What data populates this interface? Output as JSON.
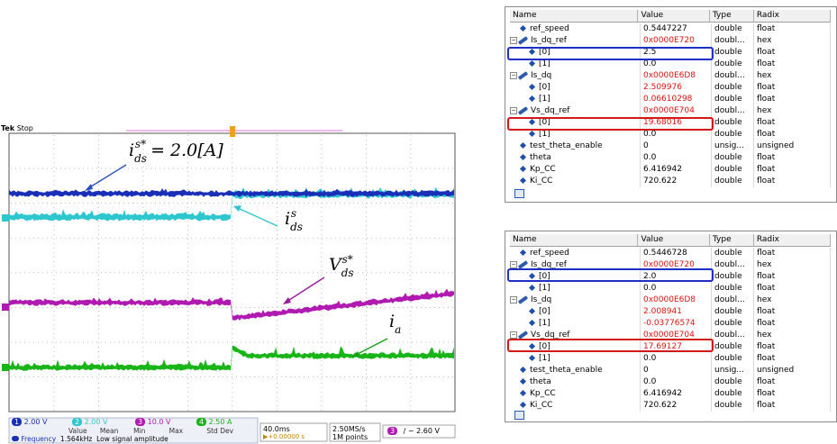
{
  "scope": {
    "brand": "Tek",
    "status": "Stop",
    "annotations": {
      "ids_ref": "i",
      "ids_ref_sub": "ds",
      "ids_ref_sup": "s*",
      "ids_ref_value": "= 2.0[A]",
      "ids": "i",
      "ids_sub": "ds",
      "ids_sup": "s",
      "vds": "V",
      "vds_sub": "ds",
      "vds_sup": "s*",
      "ia": "i",
      "ia_sub": "a"
    },
    "channels": [
      {
        "num": "1",
        "scale": "2.00 V",
        "color": "#1a2fb8"
      },
      {
        "num": "2",
        "scale": "2.00 V",
        "color": "#2ec6cf"
      },
      {
        "num": "3",
        "scale": "10.0 V",
        "color": "#b01ab0"
      },
      {
        "num": "4",
        "scale": "2.50 A",
        "color": "#18b418"
      }
    ],
    "measure": {
      "headers": [
        "Value",
        "Mean",
        "Min",
        "Max",
        "Std Dev"
      ],
      "label": "Frequency",
      "value": "1.564kHz",
      "note": "Low signal amplitude"
    },
    "timebase": "40.0ms",
    "trigger_pos": "▶+0.00000 s",
    "sample_rate": "2.50MS/s",
    "record": "1M points",
    "trigger_level": "− 2.60 V"
  },
  "panel1": {
    "headers": [
      "Name",
      "Value",
      "Type",
      "Radix"
    ],
    "rows": [
      {
        "name": "ref_speed",
        "value": "0.5447227",
        "type": "double",
        "radix": "float"
      },
      {
        "name": "Is_dq_ref",
        "value": "0x0000E720",
        "type": "doubl...",
        "radix": "hex"
      },
      {
        "name": "[0]",
        "value": "2.5",
        "type": "double",
        "radix": "float"
      },
      {
        "name": "[1]",
        "value": "0.0",
        "type": "double",
        "radix": "float"
      },
      {
        "name": "Is_dq",
        "value": "0x0000E6D8",
        "type": "doubl...",
        "radix": "hex"
      },
      {
        "name": "[0]",
        "value": "2.509976",
        "type": "double",
        "radix": "float"
      },
      {
        "name": "[1]",
        "value": "0.06610298",
        "type": "double",
        "radix": "float"
      },
      {
        "name": "Vs_dq_ref",
        "value": "0x0000E704",
        "type": "doubl...",
        "radix": "hex"
      },
      {
        "name": "[0]",
        "value": "19.68016",
        "type": "double",
        "radix": "float"
      },
      {
        "name": "[1]",
        "value": "0.0",
        "type": "double",
        "radix": "float"
      },
      {
        "name": "test_theta_enable",
        "value": "0",
        "type": "unsig...",
        "radix": "unsigned"
      },
      {
        "name": "theta",
        "value": "0.0",
        "type": "double",
        "radix": "float"
      },
      {
        "name": "Kp_CC",
        "value": "6.416942",
        "type": "double",
        "radix": "float"
      },
      {
        "name": "Ki_CC",
        "value": "720.622",
        "type": "double",
        "radix": "float"
      }
    ]
  },
  "panel2": {
    "headers": [
      "Name",
      "Value",
      "Type",
      "Radix"
    ],
    "rows": [
      {
        "name": "ref_speed",
        "value": "0.5446728",
        "type": "double",
        "radix": "float"
      },
      {
        "name": "Is_dq_ref",
        "value": "0x0000E720",
        "type": "doubl...",
        "radix": "hex"
      },
      {
        "name": "[0]",
        "value": "2.0",
        "type": "double",
        "radix": "float"
      },
      {
        "name": "[1]",
        "value": "0.0",
        "type": "double",
        "radix": "float"
      },
      {
        "name": "Is_dq",
        "value": "0x0000E6D8",
        "type": "doubl...",
        "radix": "hex"
      },
      {
        "name": "[0]",
        "value": "2.008941",
        "type": "double",
        "radix": "float"
      },
      {
        "name": "[1]",
        "value": "-0.03776574",
        "type": "double",
        "radix": "float"
      },
      {
        "name": "Vs_dq_ref",
        "value": "0x0000E704",
        "type": "doubl...",
        "radix": "hex"
      },
      {
        "name": "[0]",
        "value": "17.69127",
        "type": "double",
        "radix": "float"
      },
      {
        "name": "[1]",
        "value": "0.0",
        "type": "double",
        "radix": "float"
      },
      {
        "name": "test_theta_enable",
        "value": "0",
        "type": "unsig...",
        "radix": "unsigned"
      },
      {
        "name": "theta",
        "value": "0.0",
        "type": "double",
        "radix": "float"
      },
      {
        "name": "Kp_CC",
        "value": "6.416942",
        "type": "double",
        "radix": "float"
      },
      {
        "name": "Ki_CC",
        "value": "720.622",
        "type": "double",
        "radix": "float"
      }
    ]
  },
  "colors": {
    "changed_value": "#e01010",
    "highlight_blue": "#1f2fc8",
    "highlight_red": "#d41818"
  }
}
